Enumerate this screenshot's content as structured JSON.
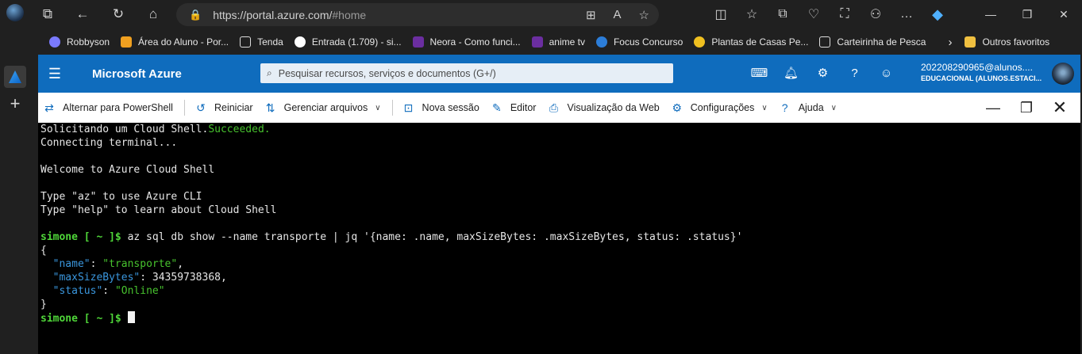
{
  "browser": {
    "url_host": "https://portal.azure.com/",
    "url_path": "#home"
  },
  "bookmarks": [
    {
      "label": "Robbyson",
      "icon": "circle-icon",
      "color": "#7a7aff"
    },
    {
      "label": "Área do Aluno - Por...",
      "icon": "lock-icon",
      "color": "#f0a020"
    },
    {
      "label": "Tenda",
      "icon": "document-icon",
      "color": "#dddddd"
    },
    {
      "label": "Entrada (1.709) - si...",
      "icon": "google-icon",
      "color": "#ffffff"
    },
    {
      "label": "Neora - Como funci...",
      "icon": "neora-icon",
      "color": "#6b2ea0"
    },
    {
      "label": "anime tv",
      "icon": "tv-icon",
      "color": "#6b2ea0"
    },
    {
      "label": "Focus Concurso",
      "icon": "focus-icon",
      "color": "#2c7dd8"
    },
    {
      "label": "Plantas de Casas Pe...",
      "icon": "house-icon",
      "color": "#f0c020"
    },
    {
      "label": "Carteirinha de Pesca",
      "icon": "document-icon",
      "color": "#dddddd"
    },
    {
      "label": "Outros favoritos",
      "icon": "folder-icon",
      "color": "#f0c040"
    }
  ],
  "azure": {
    "title": "Microsoft Azure",
    "search_placeholder": "Pesquisar recursos, serviços e documentos (G+/)",
    "user_email": "202208290965@alunos....",
    "user_directory": "EDUCACIONAL (ALUNOS.ESTACI..."
  },
  "toolbar": {
    "powershell": "Alternar para PowerShell",
    "restart": "Reiniciar",
    "manage_files": "Gerenciar arquivos",
    "new_session": "Nova sessão",
    "editor": "Editor",
    "web_preview": "Visualização da Web",
    "settings": "Configurações",
    "help": "Ajuda"
  },
  "terminal": {
    "l1_a": "Solicitando um Cloud Shell.",
    "l1_b": "Succeeded.",
    "l2": "Connecting terminal...",
    "l3": "Welcome to Azure Cloud Shell",
    "l4": "Type \"az\" to use Azure CLI",
    "l5": "Type \"help\" to learn about Cloud Shell",
    "prompt": "simone [ ~ ]$",
    "command": " az sql db show --name transporte | jq '{name: .name, maxSizeBytes: .maxSizeBytes, status: .status}'",
    "open_brace": "{",
    "key_name": "\"name\"",
    "val_name": "\"transporte\"",
    "key_size": "\"maxSizeBytes\"",
    "val_size": " 34359738368,",
    "key_status": "\"status\"",
    "val_status": "\"Online\"",
    "close_brace": "}"
  }
}
